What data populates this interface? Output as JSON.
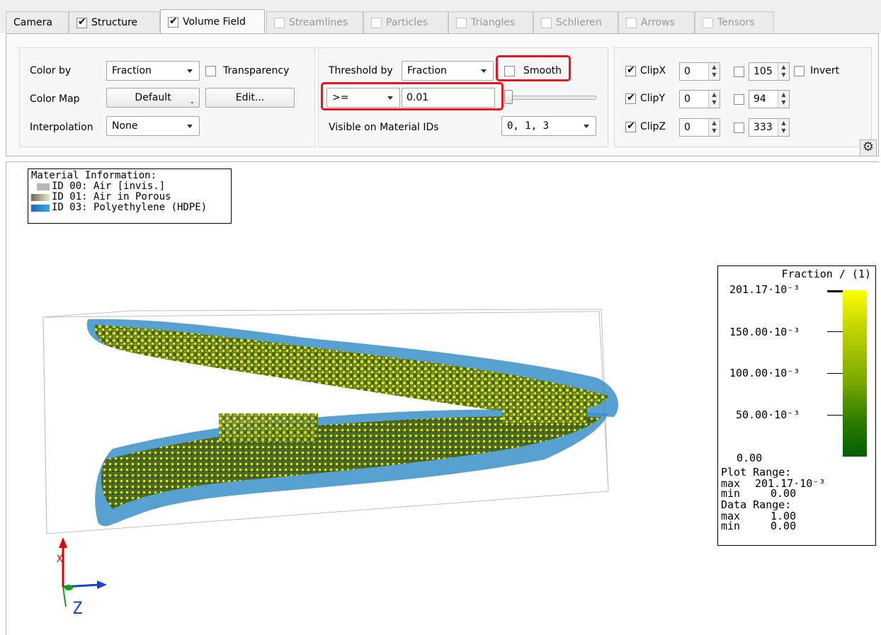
{
  "tabs": [
    {
      "label": "Camera",
      "checkbox": false,
      "checked": false,
      "enabled": true,
      "active": false
    },
    {
      "label": "Structure",
      "checkbox": true,
      "checked": true,
      "enabled": true,
      "active": false
    },
    {
      "label": "Volume Field",
      "checkbox": true,
      "checked": true,
      "enabled": true,
      "active": true
    },
    {
      "label": "Streamlines",
      "checkbox": true,
      "checked": false,
      "enabled": false,
      "active": false
    },
    {
      "label": "Particles",
      "checkbox": true,
      "checked": false,
      "enabled": false,
      "active": false
    },
    {
      "label": "Triangles",
      "checkbox": true,
      "checked": false,
      "enabled": false,
      "active": false
    },
    {
      "label": "Schlieren",
      "checkbox": true,
      "checked": false,
      "enabled": false,
      "active": false
    },
    {
      "label": "Arrows",
      "checkbox": true,
      "checked": false,
      "enabled": false,
      "active": false
    },
    {
      "label": "Tensors",
      "checkbox": true,
      "checked": false,
      "enabled": false,
      "active": false
    }
  ],
  "color": {
    "color_by_label": "Color by",
    "color_by_value": "Fraction",
    "transparency_label": "Transparency",
    "transparency_checked": false,
    "color_map_label": "Color Map",
    "color_map_value": "Default",
    "edit_label": "Edit...",
    "interpolation_label": "Interpolation",
    "interpolation_value": "None"
  },
  "threshold": {
    "label": "Threshold by",
    "value": "Fraction",
    "smooth_label": "Smooth",
    "smooth_checked": false,
    "operator": ">=",
    "threshold_value": "0.01",
    "slider_fraction": 0.0,
    "visible_label": "Visible on Material IDs",
    "visible_value": "0, 1, 3"
  },
  "clip": {
    "x": {
      "label": "ClipX",
      "checked": true,
      "min": "0",
      "max_checked": false,
      "max": "105"
    },
    "y": {
      "label": "ClipY",
      "checked": true,
      "min": "0",
      "max_checked": false,
      "max": "94"
    },
    "z": {
      "label": "ClipZ",
      "checked": true,
      "min": "0",
      "max_checked": false,
      "max": "333"
    },
    "invert_label": "Invert",
    "invert_checked": false
  },
  "settings_icon": "gear-icon",
  "material_info": {
    "title": "Material Information:",
    "items": [
      {
        "label": "ID 00: Air [invis.]",
        "color": "#b8b8b8"
      },
      {
        "label": "ID 01: Air in Porous",
        "color": "#e8e6c8"
      },
      {
        "label": "ID 03: Polyethylene (HDPE)",
        "color": "#2a8fd0"
      }
    ]
  },
  "legend": {
    "title": "Fraction / (1)",
    "ticks": [
      "201.17·10⁻³",
      "150.00·10⁻³",
      "100.00·10⁻³",
      "50.00·10⁻³",
      "0.00"
    ],
    "plot_range_label": "Plot Range:",
    "plot_max_label": "max",
    "plot_max": "201.17·10⁻³",
    "plot_min_label": "min",
    "plot_min": "0.00",
    "data_range_label": "Data Range:",
    "data_max_label": "max",
    "data_max": "1.00",
    "data_min_label": "min",
    "data_min": "0.00",
    "colors": {
      "high": "#ffff00",
      "mid": "#7aa800",
      "low": "#006000"
    }
  },
  "axes": {
    "x_label": "X",
    "z_label": "Z",
    "x_color": "#e00000",
    "z_color": "#1a3fd0",
    "y_color": "#10a010"
  }
}
